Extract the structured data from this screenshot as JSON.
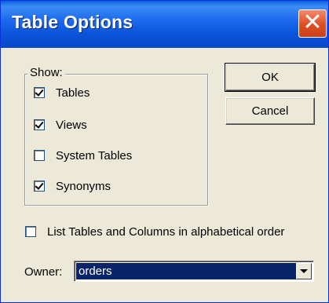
{
  "window": {
    "title": "Table Options",
    "close_glyph": "✕"
  },
  "show_group": {
    "label": "Show:",
    "options": [
      {
        "label": "Tables",
        "checked": true
      },
      {
        "label": "Views",
        "checked": true
      },
      {
        "label": "System Tables",
        "checked": false
      },
      {
        "label": "Synonyms",
        "checked": true
      }
    ]
  },
  "buttons": {
    "ok": "OK",
    "cancel": "Cancel"
  },
  "alphabetical": {
    "label": "List Tables and Columns in alphabetical order",
    "checked": false
  },
  "owner": {
    "label": "Owner:",
    "value": "orders"
  }
}
